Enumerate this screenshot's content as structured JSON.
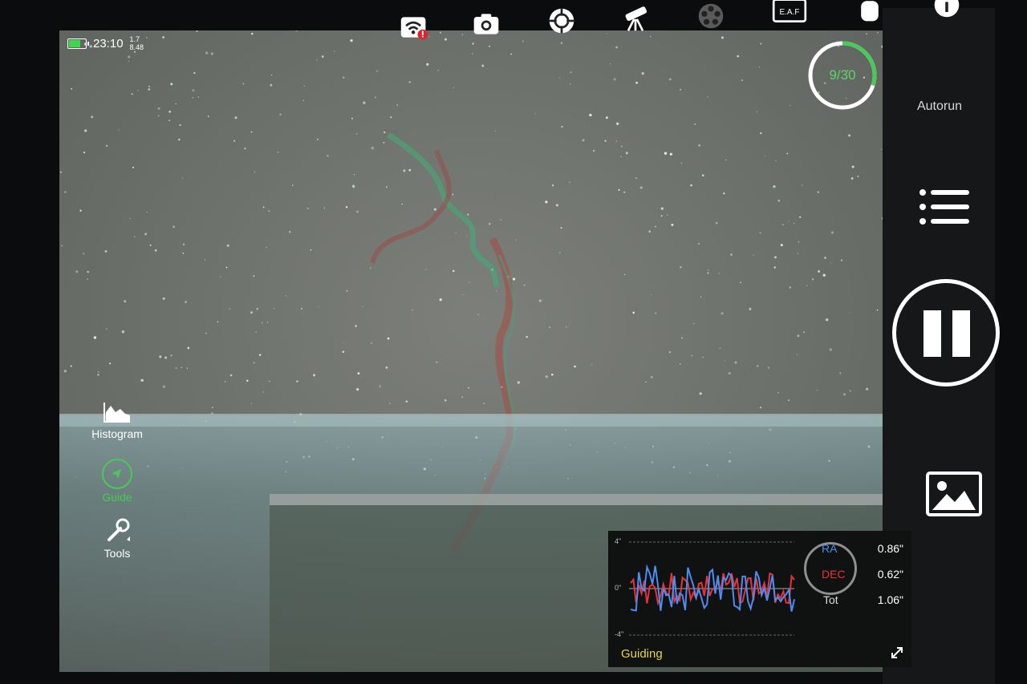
{
  "status": {
    "time": "23:10",
    "stat_top": "1.7",
    "stat_bottom": "8.48",
    "battery_level": 0.8
  },
  "toolbar": {
    "icons": [
      "wifi-warning-icon",
      "camera-icon",
      "target-icon",
      "telescope-icon",
      "filter-wheel-icon",
      "focuser-icon",
      "device-icon",
      "info-icon"
    ],
    "focuser_label": "E.A.F"
  },
  "sequence": {
    "progress_text": "9/30",
    "progress_fraction": 0.3
  },
  "right_panel": {
    "autorun_label": "Autorun"
  },
  "tools": {
    "histogram_label": "Histogram",
    "guide_label": "Guide",
    "tools_label": "Tools"
  },
  "guiding": {
    "status_label": "Guiding",
    "ra_label": "RA",
    "dec_label": "DEC",
    "tot_label": "Tot",
    "ra_value": "0.86\"",
    "dec_value": "0.62\"",
    "tot_value": "1.06\"",
    "axis_top": "4\"",
    "axis_mid": "0\"",
    "axis_bottom": "-4\"",
    "ra_color": "#4d8cf0",
    "dec_color": "#e8323a"
  },
  "colors": {
    "accent_green": "#49c95a",
    "warning_red": "#e0242c"
  }
}
